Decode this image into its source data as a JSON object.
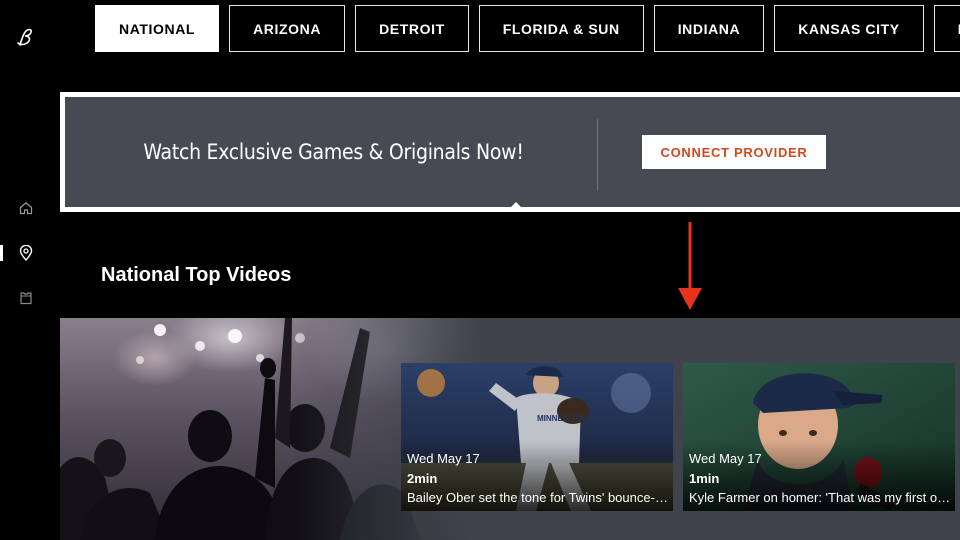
{
  "tabs": [
    {
      "label": "NATIONAL",
      "active": true
    },
    {
      "label": "ARIZONA",
      "active": false
    },
    {
      "label": "DETROIT",
      "active": false
    },
    {
      "label": "FLORIDA & SUN",
      "active": false
    },
    {
      "label": "INDIANA",
      "active": false
    },
    {
      "label": "KANSAS CITY",
      "active": false
    },
    {
      "label": "MID",
      "active": false
    }
  ],
  "sidebar": {
    "logo": "bally-b-logo",
    "items": [
      {
        "icon": "home-icon"
      },
      {
        "icon": "location-pin-icon",
        "active": true
      },
      {
        "icon": "jersey-icon"
      }
    ]
  },
  "banner": {
    "text": "Watch Exclusive Games & Originals Now!",
    "button_label": "CONNECT PROVIDER"
  },
  "section": {
    "title": "National Top Videos"
  },
  "videos": [
    {
      "date": "Wed May 17",
      "duration": "2min",
      "title": "Bailey Ober set the tone for Twins' bounce-back win"
    },
    {
      "date": "Wed May 17",
      "duration": "1min",
      "title": "Kyle Farmer on homer: 'That was my first one this year'"
    }
  ],
  "colors": {
    "banner_bg": "#454a53",
    "accent_orange": "#d2491c",
    "annotation_red": "#e8321b",
    "rail_bg": "#3f434b"
  }
}
